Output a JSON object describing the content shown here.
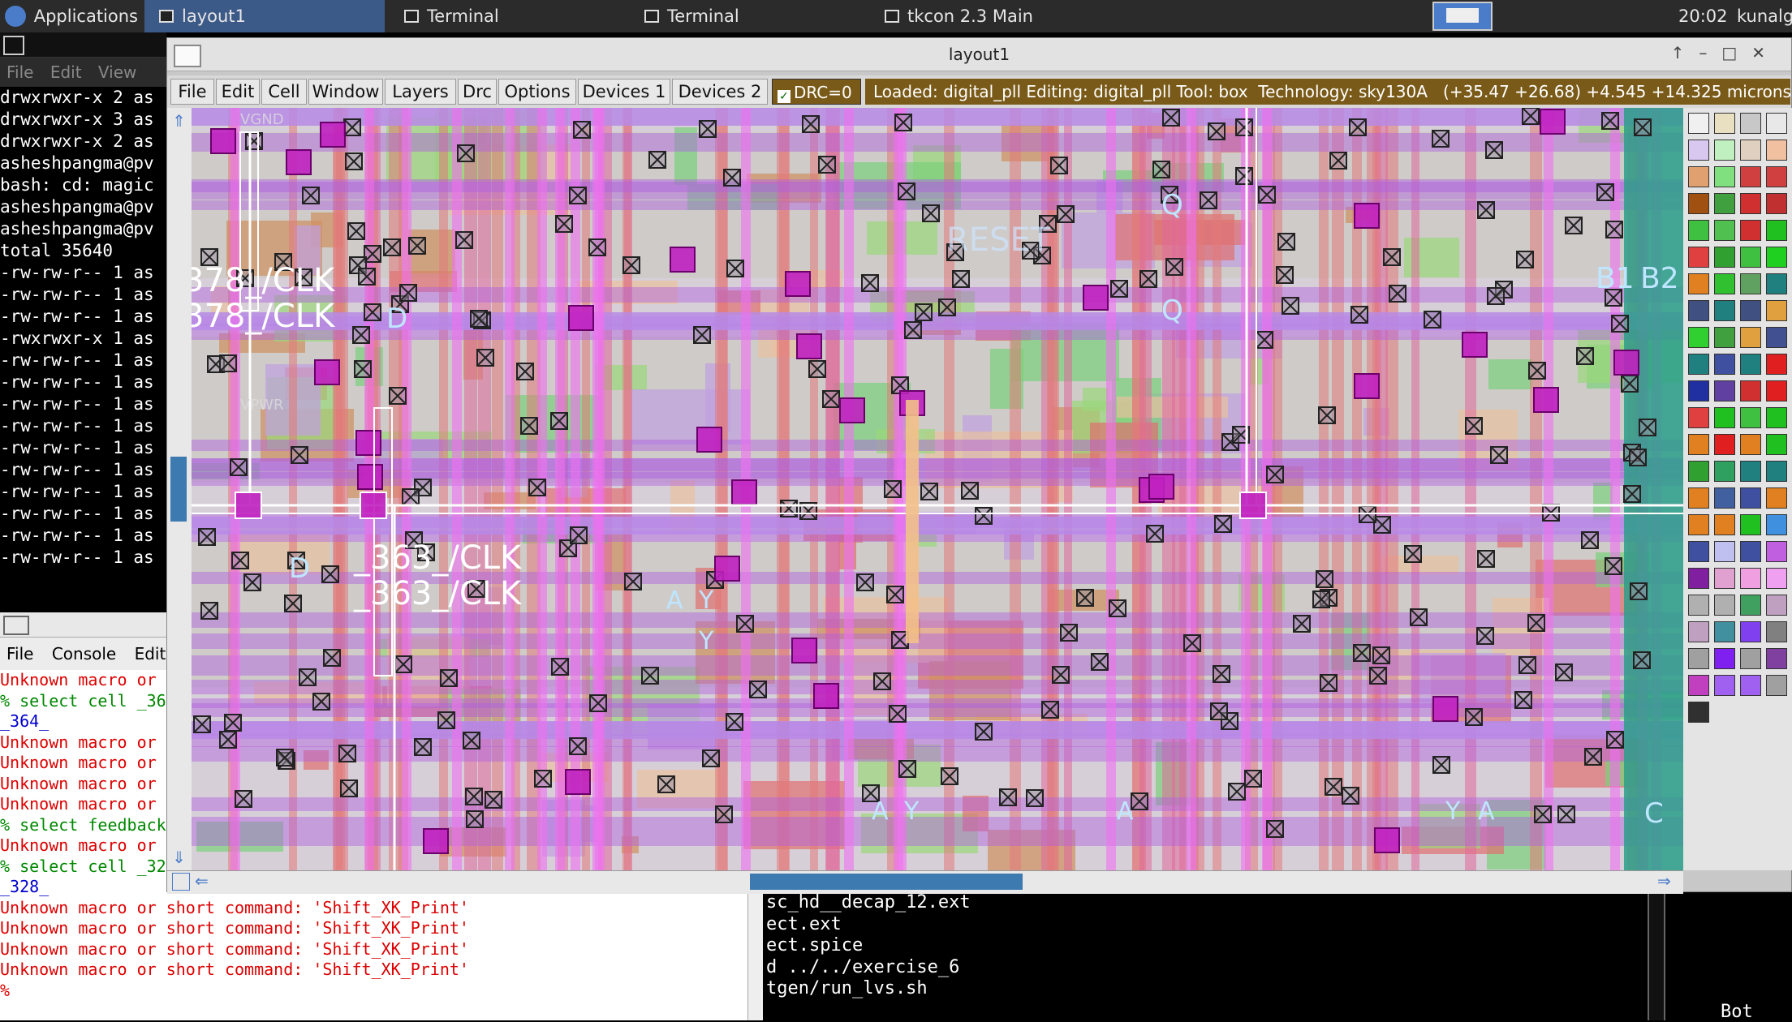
{
  "taskbar": {
    "applications": "Applications",
    "tasks": [
      "layout1",
      "Terminal",
      "Terminal",
      "tkcon 2.3 Main"
    ],
    "time": "20:02",
    "user": "kunalg"
  },
  "term_left": {
    "menu": [
      "File",
      "Edit",
      "View"
    ],
    "lines": [
      "drwxrwxr-x 2 as",
      "drwxrwxr-x 3 as",
      "drwxrwxr-x 2 as",
      "asheshpangma@pv",
      "bash: cd: magic",
      "asheshpangma@pv",
      "asheshpangma@pv",
      "total 35640",
      "-rw-rw-r-- 1 as",
      "-rw-rw-r-- 1 as",
      "-rw-rw-r-- 1 as",
      "-rwxrwxr-x 1 as",
      "-rw-rw-r-- 1 as",
      "-rw-rw-r-- 1 as",
      "-rw-rw-r-- 1 as",
      "-rw-rw-r-- 1 as",
      "-rw-rw-r-- 1 as",
      "-rw-rw-r-- 1 as",
      "-rw-rw-r-- 1 as",
      "-rw-rw-r-- 1 as",
      "-rw-rw-r-- 1 as",
      "-rw-rw-r-- 1 as"
    ]
  },
  "tkcon": {
    "menu": [
      "File",
      "Console",
      "Edit"
    ],
    "lines": [
      {
        "t": "Unknown macro or",
        "c": "#d00"
      },
      {
        "t": "% select cell _36",
        "c": "#080"
      },
      {
        "t": "_364_",
        "c": "#00c"
      },
      {
        "t": "Unknown macro or",
        "c": "#d00"
      },
      {
        "t": "Unknown macro or",
        "c": "#d00"
      },
      {
        "t": "Unknown macro or",
        "c": "#d00"
      },
      {
        "t": "Unknown macro or",
        "c": "#d00"
      },
      {
        "t": "% select feedback",
        "c": "#080"
      },
      {
        "t": "Unknown macro or",
        "c": "#d00"
      },
      {
        "t": "% select cell _32",
        "c": "#080"
      },
      {
        "t": "_328_",
        "c": "#00c"
      },
      {
        "t": "Unknown macro or short command: 'Shift_XK_Print'",
        "c": "#d00"
      },
      {
        "t": "Unknown macro or short command: 'Shift_XK_Print'",
        "c": "#d00"
      },
      {
        "t": "Unknown macro or short command: 'Shift_XK_Print'",
        "c": "#d00"
      },
      {
        "t": "Unknown macro or short command: 'Shift_XK_Print'",
        "c": "#d00"
      },
      {
        "t": "%",
        "c": "#d00"
      }
    ]
  },
  "term_bottom": {
    "lines": [
      "sc_hd__decap_12.ext",
      "ect.ext",
      "ect.spice",
      "d ../../exercise_6",
      "tgen/run_lvs.sh"
    ],
    "status": "Bot"
  },
  "magic": {
    "title": "layout1",
    "menu": [
      "File",
      "Edit",
      "Cell",
      "Window",
      "Layers",
      "Drc",
      "Options",
      "Devices 1",
      "Devices 2"
    ],
    "drc": "DRC=0",
    "status": "Loaded: digital_pll Editing: digital_pll Tool: box  Technology: sky130A   (+35.47 +26.68) +4.545 +14.325 microns",
    "labels": [
      "378_/CLK",
      "378_/CLK",
      "_363_/CLK",
      "_363_/CLK",
      "D",
      "D",
      "Q",
      "Q",
      "A",
      "Y",
      "Y",
      "A",
      "Y",
      "A",
      "A",
      "Y",
      "B1",
      "B2",
      "RESET",
      "VGND",
      "VPWR",
      "C"
    ]
  },
  "colors": {
    "accent": "#3c5a87",
    "metal1": "#b060e0",
    "poly": "#e05050",
    "diff": "#40c040",
    "li": "#8080ff",
    "status_bg": "#7a5a18"
  },
  "palette": [
    "#f0f0f0",
    "#e8e0c0",
    "#c8c8c8",
    "#e8e8e8",
    "#d8c8f0",
    "#c0f0c0",
    "#e0d0c0",
    "#f0c0a0",
    "#e0a070",
    "#80e080",
    "#d04040",
    "#d04040",
    "#a05010",
    "#40a040",
    "#d03030",
    "#c03030",
    "#40c040",
    "#50c050",
    "#d03030",
    "#20c020",
    "#e04040",
    "#30a030",
    "#40c040",
    "#20d020",
    "#e08020",
    "#30c030",
    "#60a060",
    "#208080",
    "#405080",
    "#208080",
    "#405080",
    "#e0a040",
    "#30d030",
    "#40a040",
    "#e0a040",
    "#405090",
    "#208080",
    "#4050a0",
    "#208080",
    "#e02020",
    "#2030a0",
    "#6040a0",
    "#d03030",
    "#e02020",
    "#e04040",
    "#20c020",
    "#40c040",
    "#20c020",
    "#e08020",
    "#e02020",
    "#e08020",
    "#20c020",
    "#30a030",
    "#30a060",
    "#208080",
    "#208080",
    "#e08020",
    "#4060a0",
    "#4050a0",
    "#e08020",
    "#e08020",
    "#e08020",
    "#20c020",
    "#4090e0",
    "#4050a0",
    "#c0c0f0",
    "#4050a0",
    "#c060e0",
    "#8020a0",
    "#e0a0d0",
    "#f0a0e0",
    "#f0a0f0",
    "#b0b0b0",
    "#b0b0b0",
    "#40a060",
    "#c0a0c0",
    "#c0a0c0",
    "#4090a0",
    "#8040f0",
    "#808080",
    "#a0a0a0",
    "#8020f0",
    "#a0a0a0",
    "#8040a0",
    "#c040c0",
    "#a060f0",
    "#a060f0",
    "#a0a0a0",
    "#303030"
  ]
}
